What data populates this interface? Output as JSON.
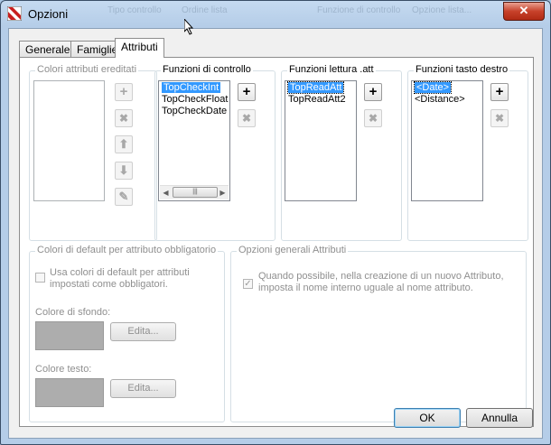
{
  "window": {
    "title": "Opzioni",
    "close_glyph": "✕",
    "ghost_titles": [
      "...",
      "Tipo controllo",
      "Ordine lista",
      "Funzione di controllo",
      "Opzione lista..."
    ]
  },
  "tabs": [
    {
      "label": "Generale"
    },
    {
      "label": "Famiglie"
    },
    {
      "label": "Attributi",
      "active": true
    }
  ],
  "inherited": {
    "title": "Colori attributi ereditati",
    "items": [],
    "buttons": [
      "add-icon",
      "delete-icon",
      "arrow-up-icon",
      "arrow-down-icon",
      "pencil-icon"
    ]
  },
  "control_functions": {
    "title": "Funzioni di controllo",
    "items": [
      "TopCheckInt",
      "TopCheckFloat",
      "TopCheckDate"
    ],
    "selected": "TopCheckInt"
  },
  "read_functions": {
    "title": "Funzioni lettura .att",
    "items": [
      "TopReadAtt",
      "TopReadAtt2"
    ],
    "selected": "TopReadAtt"
  },
  "rightclick_functions": {
    "title": "Funzioni tasto destro",
    "items": [
      "<Date>",
      "<Distance>"
    ],
    "selected": "<Date>"
  },
  "default_colors": {
    "title": "Colori di default per attributo obbligatorio",
    "checkbox_label": "Usa colori di default per attributi impostati come obbligatori.",
    "checked": false,
    "background_label": "Colore di sfondo:",
    "text_label": "Colore testo:",
    "edit_label": "Edita...",
    "swatch_color": "#adadad"
  },
  "general_options": {
    "title": "Opzioni generali Attributi",
    "checkbox_label": "Quando possibile, nella creazione di un nuovo Attributo, imposta il nome interno uguale al nome attributo.",
    "checked": true
  },
  "footer": {
    "ok_label": "OK",
    "cancel_label": "Annulla"
  },
  "glyphs": {
    "add": "+",
    "delete": "✖",
    "up": "⬆",
    "down": "⬇",
    "pencil": "✎",
    "scroll_left": "◀",
    "scroll_right": "▶",
    "thumb_grip": "|||",
    "check": "✓"
  }
}
